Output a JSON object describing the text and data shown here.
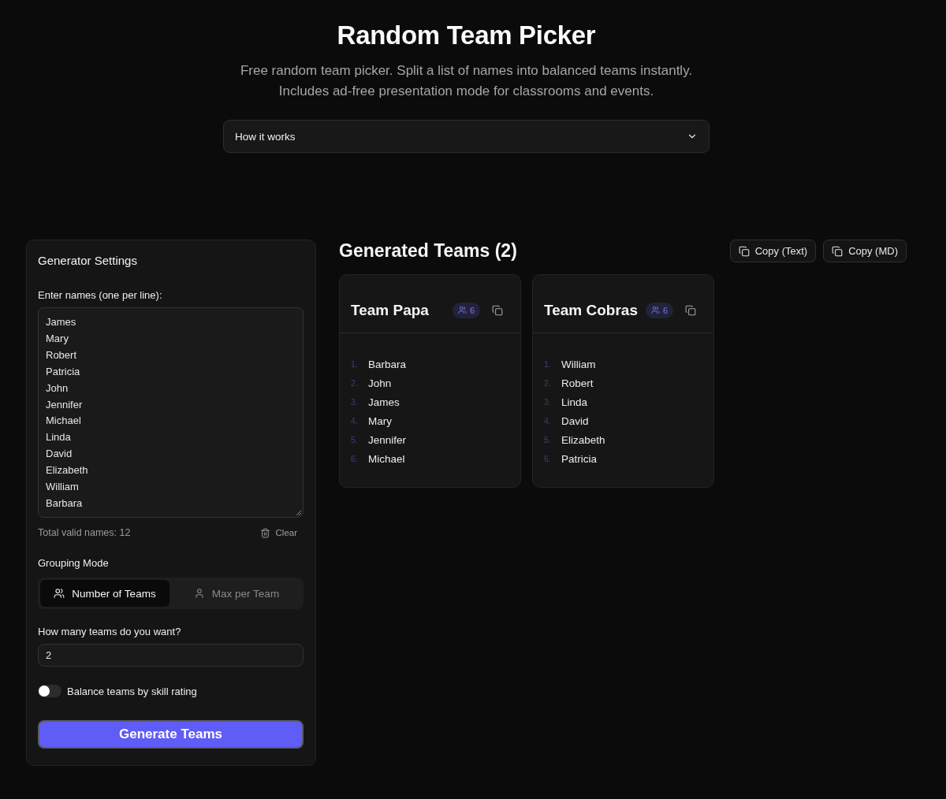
{
  "header": {
    "title": "Random Team Picker",
    "subtitle_lines": [
      "Free random team picker. Split a list of names into balanced teams instantly.",
      "Includes ad-free presentation mode for classrooms and events."
    ]
  },
  "accordion": {
    "label": "How it works",
    "expanded": false
  },
  "settings": {
    "title": "Generator Settings",
    "names_label": "Enter names (one per line):",
    "names": [
      "James",
      "Mary",
      "Robert",
      "Patricia",
      "John",
      "Jennifer",
      "Michael",
      "Linda",
      "David",
      "Elizabeth",
      "William",
      "Barbara"
    ],
    "total_label": "Total valid names: 12",
    "clear_label": "Clear",
    "grouping_label": "Grouping Mode",
    "modes": [
      {
        "label": "Number of Teams",
        "selected": true
      },
      {
        "label": "Max per Team",
        "selected": false
      }
    ],
    "count_label": "How many teams do you want?",
    "count_value": "2",
    "balance": {
      "label": "Balance teams by skill rating",
      "on": false
    },
    "generate_label": "Generate Teams"
  },
  "results": {
    "title": "Generated Teams (2)",
    "actions": [
      "Copy (Text)",
      "Copy (MD)"
    ],
    "teams": [
      {
        "name": "Team Papa",
        "count": "6",
        "members": [
          {
            "number": "1.",
            "name": "Barbara"
          },
          {
            "number": "2.",
            "name": "John"
          },
          {
            "number": "3.",
            "name": "James"
          },
          {
            "number": "4.",
            "name": "Mary"
          },
          {
            "number": "5.",
            "name": "Jennifer"
          },
          {
            "number": "6.",
            "name": "Michael"
          }
        ]
      },
      {
        "name": "Team Cobras",
        "count": "6",
        "members": [
          {
            "number": "1.",
            "name": "William"
          },
          {
            "number": "2.",
            "name": "Robert"
          },
          {
            "number": "3.",
            "name": "Linda"
          },
          {
            "number": "4.",
            "name": "David"
          },
          {
            "number": "5.",
            "name": "Elizabeth"
          },
          {
            "number": "6.",
            "name": "Patricia"
          }
        ]
      }
    ]
  }
}
